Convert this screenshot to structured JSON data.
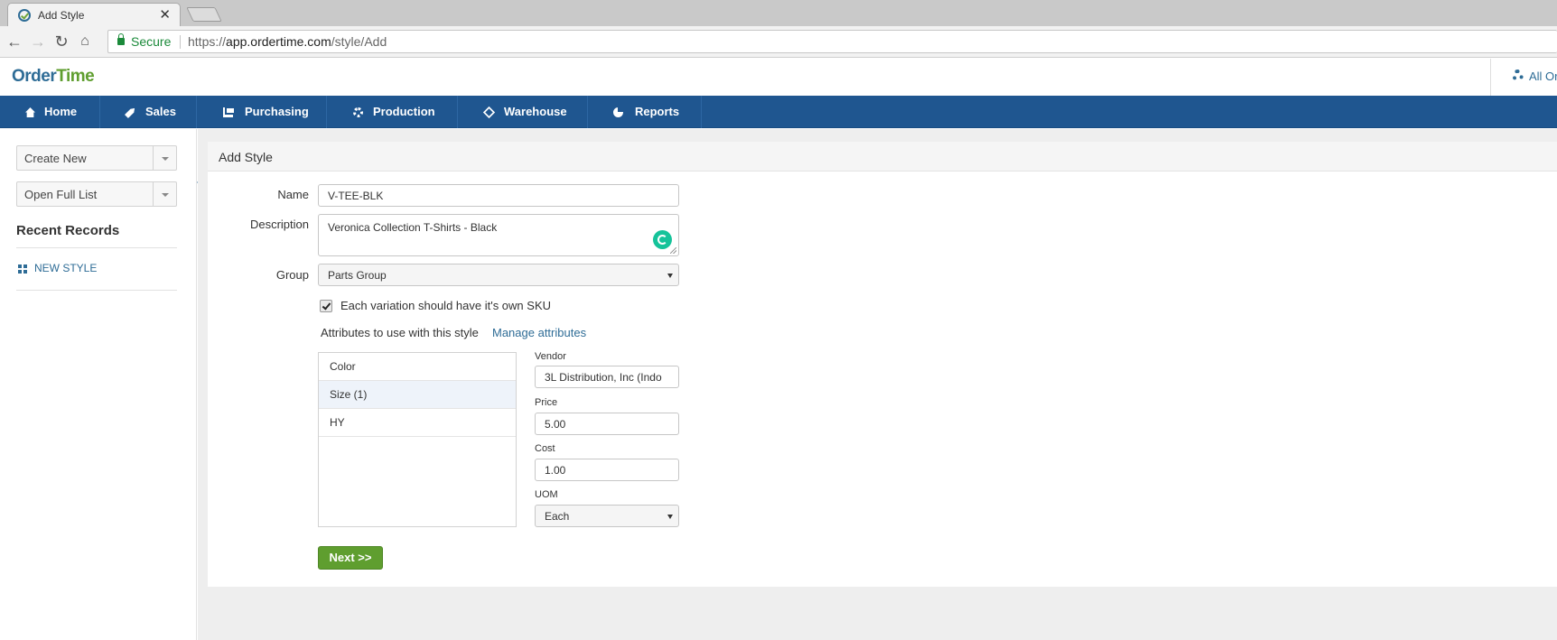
{
  "browser": {
    "tab_title": "Add Style",
    "tab_close": "✕",
    "secure_label": "Secure",
    "url_scheme": "https://",
    "url_host": "app.ordertime.com",
    "url_path": "/style/Add"
  },
  "header": {
    "logo_part1": "Order",
    "logo_part2": "Time",
    "right_text": "All Or"
  },
  "nav": {
    "items": [
      {
        "label": "Home",
        "icon": "home-icon"
      },
      {
        "label": "Sales",
        "icon": "tag-icon"
      },
      {
        "label": "Purchasing",
        "icon": "cart-icon"
      },
      {
        "label": "Production",
        "icon": "cogs-icon"
      },
      {
        "label": "Warehouse",
        "icon": "cube-icon"
      },
      {
        "label": "Reports",
        "icon": "pie-chart-icon"
      }
    ]
  },
  "sidebar": {
    "create_new": "Create New",
    "open_full_list": "Open Full List",
    "recent_title": "Recent Records",
    "recent_items": [
      "NEW STYLE"
    ]
  },
  "form": {
    "panel_title": "Add Style",
    "name_label": "Name",
    "name_value": "V-TEE-BLK",
    "description_label": "Description",
    "description_value": "Veronica Collection T-Shirts - Black",
    "group_label": "Group",
    "group_value": "Parts Group",
    "sku_checkbox_label": "Each variation should have it's own SKU",
    "sku_checked": true,
    "attributes_label": "Attributes to use with this style",
    "manage_attributes": "Manage attributes",
    "attributes": [
      "Color",
      "Size (1)",
      "HY"
    ],
    "selected_attribute": "Size (1)",
    "vendor_label": "Vendor",
    "vendor_value": "3L Distribution, Inc (Indo",
    "price_label": "Price",
    "price_value": "5.00",
    "cost_label": "Cost",
    "cost_value": "1.00",
    "uom_label": "UOM",
    "uom_value": "Each",
    "next_button": "Next >>"
  },
  "colors": {
    "nav_bg": "#1f5690",
    "link": "#2e6c96",
    "accent_green": "#5f9e2f",
    "secure_green": "#1b8a3a"
  }
}
